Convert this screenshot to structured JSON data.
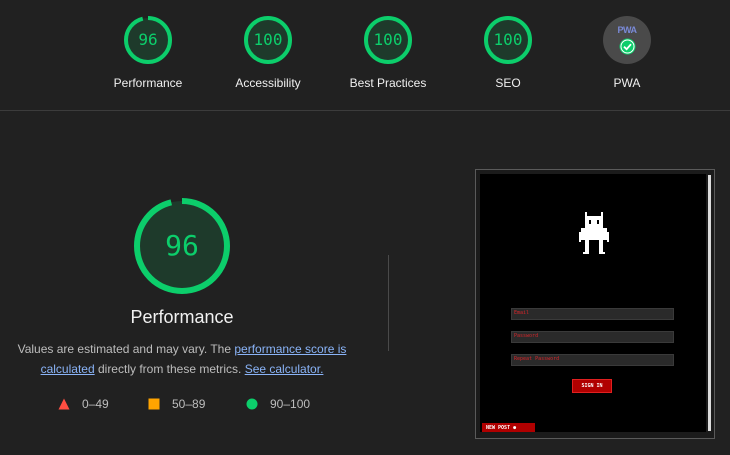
{
  "categories": [
    {
      "key": "performance",
      "score": "96",
      "label": "Performance",
      "fraction": 0.96
    },
    {
      "key": "accessibility",
      "score": "100",
      "label": "Accessibility",
      "fraction": 1.0
    },
    {
      "key": "best_practices",
      "score": "100",
      "label": "Best Practices",
      "fraction": 1.0
    },
    {
      "key": "seo",
      "score": "100",
      "label": "SEO",
      "fraction": 1.0
    }
  ],
  "pwa": {
    "badge_text": "PWA",
    "label": "PWA",
    "icon": "check-icon"
  },
  "main": {
    "score": "96",
    "fraction": 0.96,
    "title": "Performance",
    "desc_pre": "Values are estimated and may vary. The ",
    "desc_link1": "performance score is calculated",
    "desc_mid": " directly from these metrics. ",
    "desc_link2": "See calculator."
  },
  "legend": [
    {
      "shape": "triangle",
      "range": "0–49",
      "color": "#ff4e42"
    },
    {
      "shape": "square",
      "range": "50–89",
      "color": "#ffa400"
    },
    {
      "shape": "circle",
      "range": "90–100",
      "color": "#0cce6b"
    }
  ],
  "screenshot": {
    "fields": [
      "Email",
      "Password",
      "Repeat Password"
    ],
    "signin": "SIGN IN",
    "newpost": "NEW POST ●"
  },
  "colors": {
    "pass": "#0cce6b",
    "background": "#212121"
  }
}
